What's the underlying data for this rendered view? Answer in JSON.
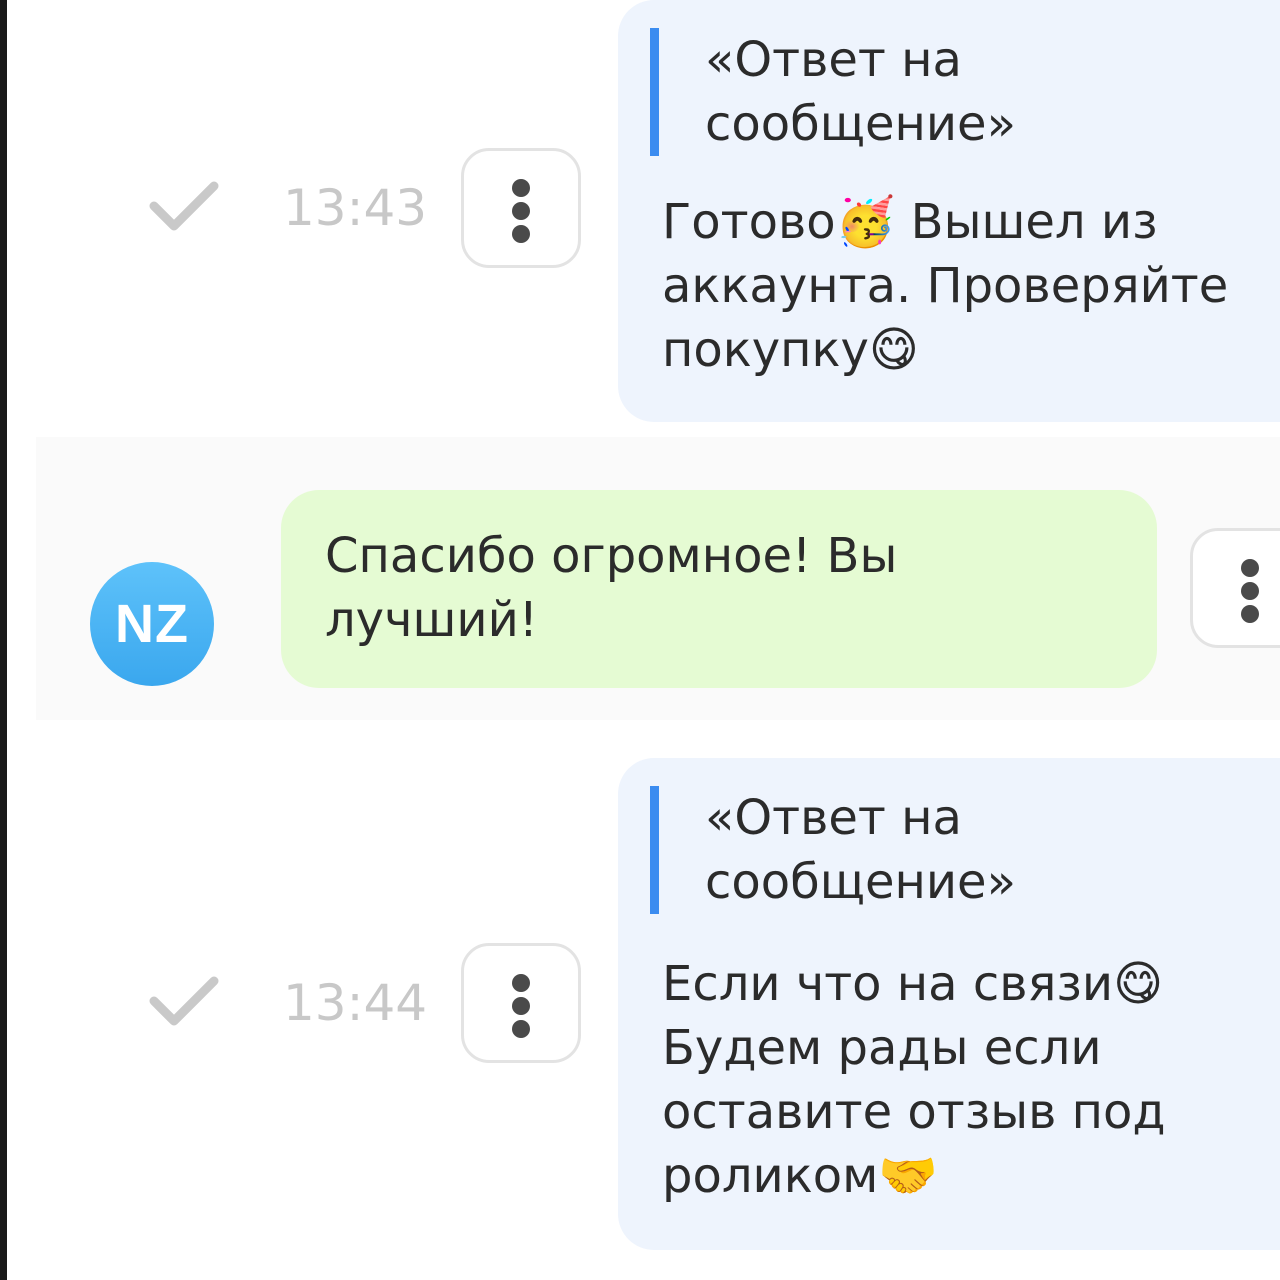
{
  "messages": [
    {
      "direction": "outgoing",
      "quote": "«Ответ на\nсообщение»",
      "text": "Готово🥳 Вышел из\nаккаунта. Проверяйте\nпокупку😋",
      "time": "13:43",
      "status_icon": "check-icon",
      "menu_icon": "more-vertical-icon"
    },
    {
      "direction": "incoming",
      "avatar_initials": "NZ",
      "text": "Спасибо огромное! Вы\nлучший!",
      "menu_icon": "more-vertical-icon"
    },
    {
      "direction": "outgoing",
      "quote": "«Ответ на\nсообщение»",
      "text": "Если что на связи😋\nБудем рады если\nоставите отзыв под\nроликом🤝",
      "time": "13:44",
      "status_icon": "check-icon",
      "menu_icon": "more-vertical-icon"
    }
  ],
  "colors": {
    "outgoing_bubble": "#eef4fd",
    "incoming_bubble": "#e5fbd3",
    "quote_bar": "#3b8cf0",
    "avatar": "#4fb6f4",
    "timestamp": "#c8c8c8"
  }
}
